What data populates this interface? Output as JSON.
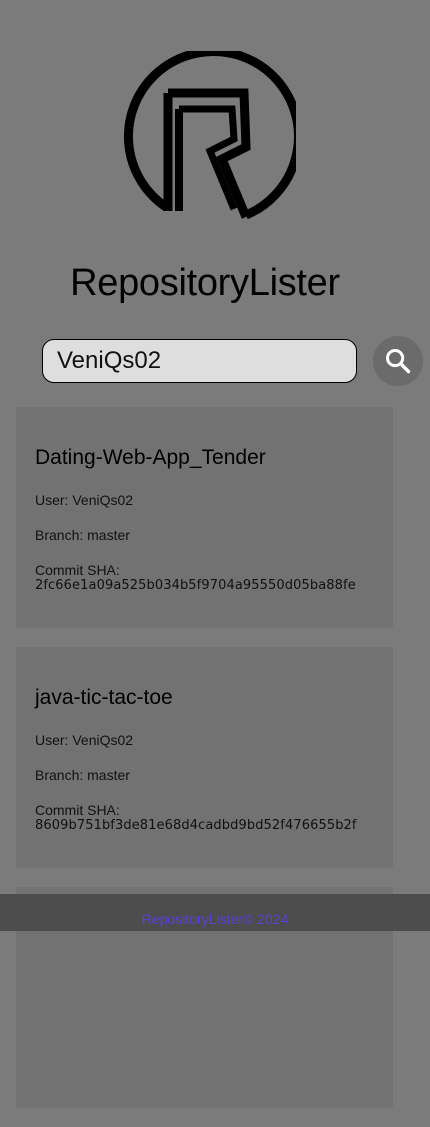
{
  "app": {
    "title": "RepositoryLister"
  },
  "search": {
    "value": "VeniQs02"
  },
  "repos": [
    {
      "name": "Dating-Web-App_Tender",
      "user": "User: VeniQs02",
      "branch": "Branch: master",
      "sha_label": "Commit SHA:",
      "sha": "2fc66e1a09a525b034b5f9704a95550d05ba88fe"
    },
    {
      "name": "java-tic-tac-toe",
      "user": "User: VeniQs02",
      "branch": "Branch: master",
      "sha_label": "Commit SHA:",
      "sha": "8609b751bf3de81e68d4cadbd9bd52f476655b2f"
    }
  ],
  "footer": {
    "text": "RepositoryLister© 2024"
  },
  "icons": {
    "logo": "r-circle-logo-icon",
    "search": "search-icon"
  },
  "colors": {
    "background": "#7b7b7b",
    "card": "#727272",
    "footer_bg": "#4d4d4d",
    "footer_text": "#5b3fd6"
  }
}
